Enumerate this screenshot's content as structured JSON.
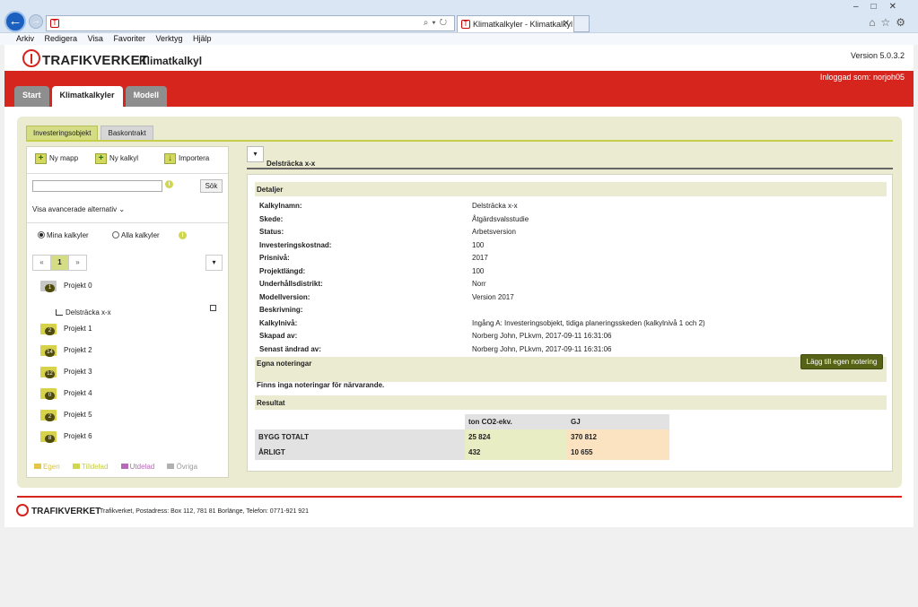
{
  "browser": {
    "tab_title": "Klimatkalkyler - Klimatkalkyl",
    "menu": [
      "Arkiv",
      "Redigera",
      "Visa",
      "Favoriter",
      "Verktyg",
      "Hjälp"
    ]
  },
  "header": {
    "brand": "TRAFIKVERKET",
    "app_title": "Klimatkalkyl",
    "version": "Version 5.0.3.2",
    "user": "Inloggad som: norjoh05"
  },
  "main_tabs": [
    "Start",
    "Klimatkalkyler",
    "Modell"
  ],
  "sub_tabs": [
    "Investeringsobjekt",
    "Baskontrakt"
  ],
  "left": {
    "actions": [
      "Ny mapp",
      "Ny kalkyl",
      "Importera"
    ],
    "search_button": "Sök",
    "advanced": "Visa avancerade alternativ",
    "radios": [
      "Mina kalkyler",
      "Alla kalkyler"
    ],
    "pager": [
      "«",
      "1",
      "»"
    ],
    "folders": [
      {
        "label": "Projekt 0",
        "count": "1"
      },
      {
        "label": "Projekt 1",
        "count": "2"
      },
      {
        "label": "Projekt 2",
        "count": "14"
      },
      {
        "label": "Projekt 3",
        "count": "12"
      },
      {
        "label": "Projekt 4",
        "count": "0"
      },
      {
        "label": "Projekt 5",
        "count": "2"
      },
      {
        "label": "Projekt 6",
        "count": "8"
      }
    ],
    "leaf": "Delsträcka x-x",
    "legend": [
      "Egen",
      "Tilldelad",
      "Utdelad",
      "Övriga"
    ]
  },
  "detail": {
    "title": "Delsträcka x-x",
    "section_details": "Detaljer",
    "rows": [
      {
        "k": "Kalkylnamn:",
        "v": "Delsträcka x-x"
      },
      {
        "k": "Skede:",
        "v": "Åtgärdsvalsstudie"
      },
      {
        "k": "Status:",
        "v": "Arbetsversion"
      },
      {
        "k": "Investeringskostnad:",
        "v": "100"
      },
      {
        "k": "Prisnivå:",
        "v": "2017"
      },
      {
        "k": "Projektlängd:",
        "v": "100"
      },
      {
        "k": "Underhållsdistrikt:",
        "v": "Norr"
      },
      {
        "k": "Modellversion:",
        "v": "Version 2017"
      },
      {
        "k": "Beskrivning:",
        "v": ""
      },
      {
        "k": "Kalkylnivå:",
        "v": "Ingång A: Investeringsobjekt, tidiga planeringsskeden (kalkylnivå 1 och 2)"
      },
      {
        "k": "Skapad av:",
        "v": "Norberg John, PLkvm, 2017-09-11 16:31:06"
      },
      {
        "k": "Senast ändrad av:",
        "v": "Norberg John, PLkvm, 2017-09-11 16:31:06"
      }
    ],
    "section_notes": "Egna noteringar",
    "add_note_button": "Lägg till egen notering",
    "no_notes": "Finns inga noteringar för närvarande.",
    "section_result": "Resultat",
    "result_headers": [
      "ton CO2-ekv.",
      "GJ"
    ],
    "result_rows": [
      {
        "label": "BYGG TOTALT",
        "co2": "25 824",
        "gj": "370 812"
      },
      {
        "label": "ÅRLIGT",
        "co2": "432",
        "gj": "10 655"
      }
    ]
  },
  "footer": {
    "brand": "TRAFIKVERKET",
    "address": "Trafikverket, Postadress: Box 112, 781 81 Borlänge, Telefon: 0771-921 921"
  },
  "colors": {
    "accent_red": "#d5251d",
    "accent_green": "#c6cf4a",
    "button_green": "#566316"
  }
}
